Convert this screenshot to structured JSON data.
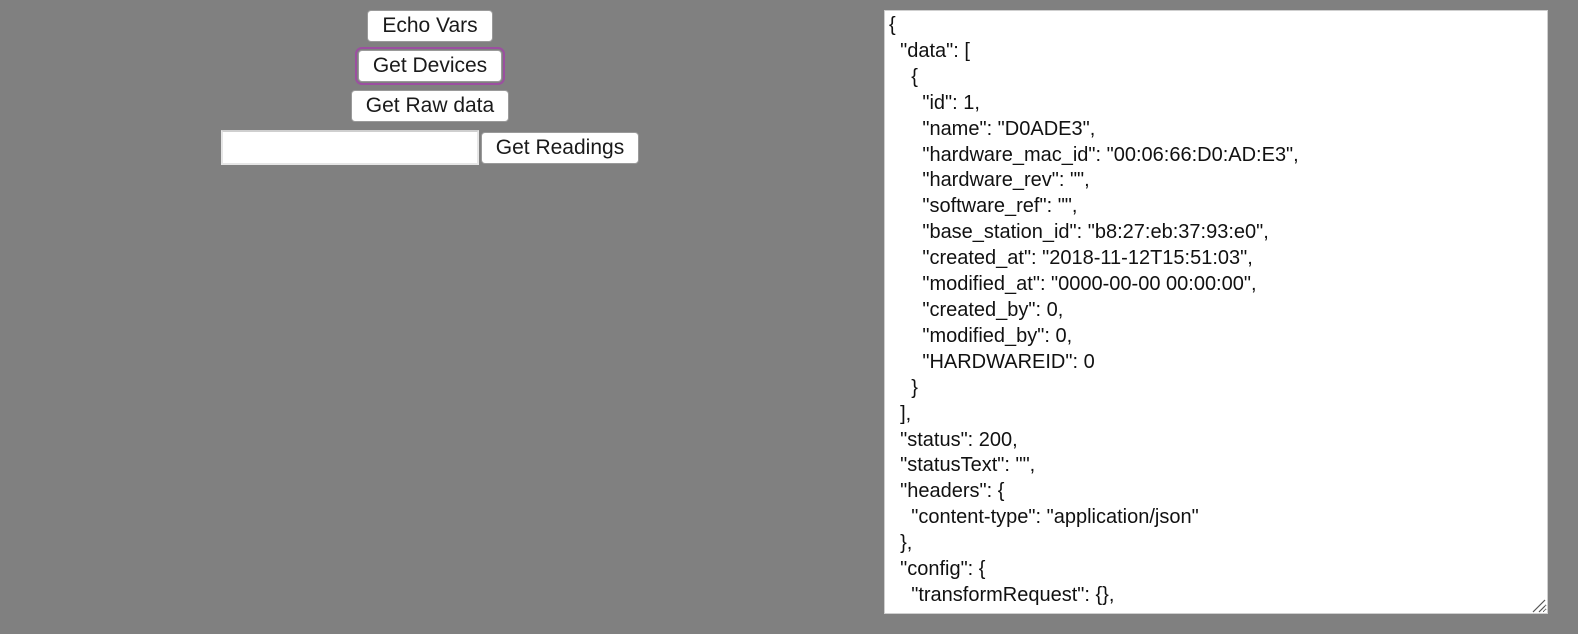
{
  "buttons": {
    "echo_vars": "Echo Vars",
    "get_devices": "Get Devices",
    "get_raw_data": "Get Raw data",
    "get_readings": "Get Readings"
  },
  "readings_input": {
    "value": "",
    "placeholder": ""
  },
  "output": {
    "text": "{\n  \"data\": [\n    {\n      \"id\": 1,\n      \"name\": \"D0ADE3\",\n      \"hardware_mac_id\": \"00:06:66:D0:AD:E3\",\n      \"hardware_rev\": \"\",\n      \"software_ref\": \"\",\n      \"base_station_id\": \"b8:27:eb:37:93:e0\",\n      \"created_at\": \"2018-11-12T15:51:03\",\n      \"modified_at\": \"0000-00-00 00:00:00\",\n      \"created_by\": 0,\n      \"modified_by\": 0,\n      \"HARDWAREID\": 0\n    }\n  ],\n  \"status\": 200,\n  \"statusText\": \"\",\n  \"headers\": {\n    \"content-type\": \"application/json\"\n  },\n  \"config\": {\n    \"transformRequest\": {},"
  },
  "colors": {
    "background": "#808080",
    "focus_ring": "#9b4fa0"
  }
}
